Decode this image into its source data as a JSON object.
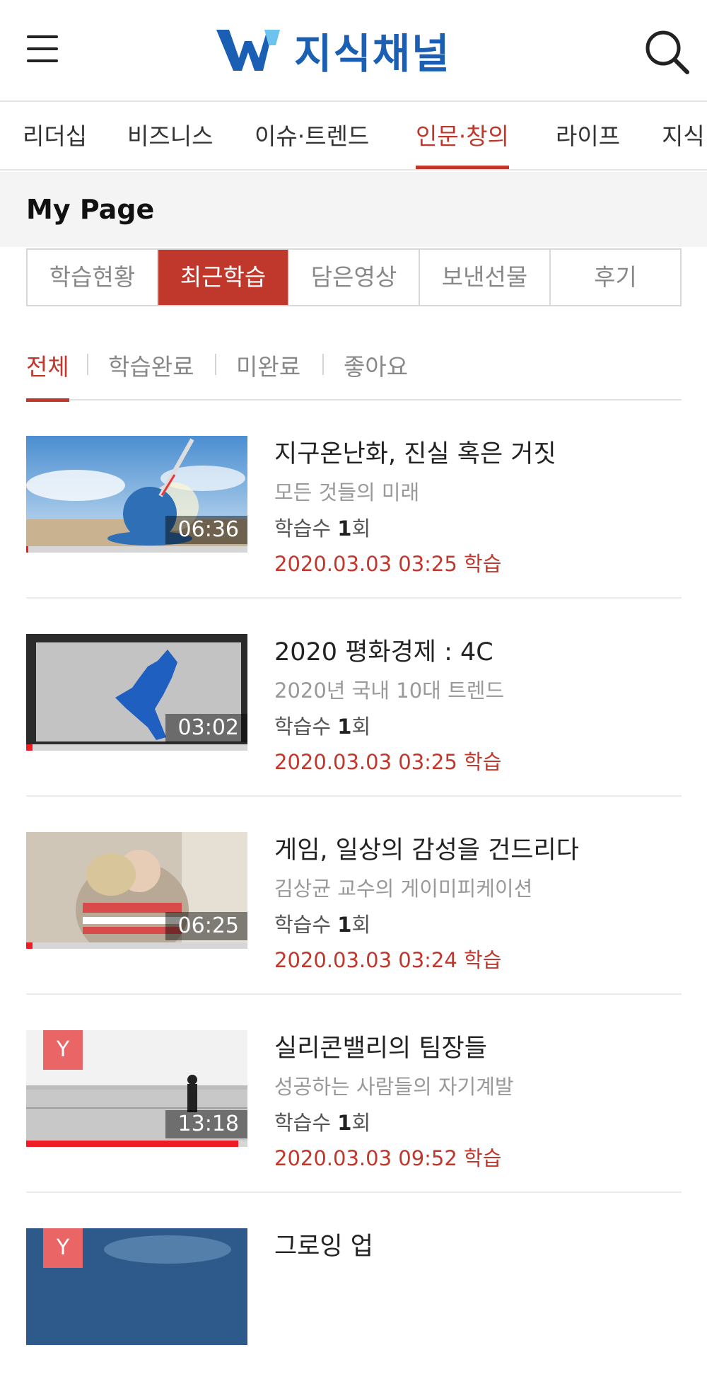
{
  "header": {
    "logo_text": "지식채널",
    "brand_color": "#1a5fb4",
    "accent_color": "#c0382b",
    "menu_icon": "hamburger-icon",
    "search_icon": "search-icon"
  },
  "categories": [
    {
      "label": "리더십"
    },
    {
      "label": "비즈니스"
    },
    {
      "label": "이슈·트렌드"
    },
    {
      "label": "인문·창의",
      "active": true
    },
    {
      "label": "라이프"
    },
    {
      "label": "지식"
    }
  ],
  "mypage": {
    "title": "My Page",
    "tabs": [
      {
        "label": "학습현황"
      },
      {
        "label": "최근학습",
        "active": true
      },
      {
        "label": "담은영상"
      },
      {
        "label": "보낸선물"
      },
      {
        "label": "후기"
      }
    ],
    "filters": [
      {
        "label": "전체",
        "active": true
      },
      {
        "label": "학습완료"
      },
      {
        "label": "미완료"
      },
      {
        "label": "좋아요"
      }
    ]
  },
  "items": [
    {
      "title": "지구온난화, 진실 혹은 거짓",
      "subtitle": "모든 것들의 미래",
      "count_label": "학습수 ",
      "count_value": "1",
      "count_unit": "회",
      "date": "2020.03.03 03:25 학습",
      "duration": "06:36",
      "progress": 0.01,
      "badge": ""
    },
    {
      "title": "2020 평화경제 : 4C",
      "subtitle": "2020년 국내 10대 트렌드",
      "count_label": "학습수 ",
      "count_value": "1",
      "count_unit": "회",
      "date": "2020.03.03 03:25 학습",
      "duration": "03:02",
      "progress": 0.03,
      "badge": ""
    },
    {
      "title": "게임, 일상의 감성을 건드리다",
      "subtitle": "김상균 교수의 게이미피케이션",
      "count_label": "학습수 ",
      "count_value": "1",
      "count_unit": "회",
      "date": "2020.03.03 03:24 학습",
      "duration": "06:25",
      "progress": 0.03,
      "badge": ""
    },
    {
      "title": "실리콘밸리의 팀장들",
      "subtitle": "성공하는 사람들의 자기계발",
      "count_label": "학습수 ",
      "count_value": "1",
      "count_unit": "회",
      "date": "2020.03.03 09:52 학습",
      "duration": "13:18",
      "progress": 0.96,
      "badge": "Y"
    },
    {
      "title": "그로잉 업",
      "subtitle": "",
      "count_label": "",
      "count_value": "",
      "count_unit": "",
      "date": "",
      "duration": "",
      "progress": 0,
      "badge": "Y"
    }
  ]
}
